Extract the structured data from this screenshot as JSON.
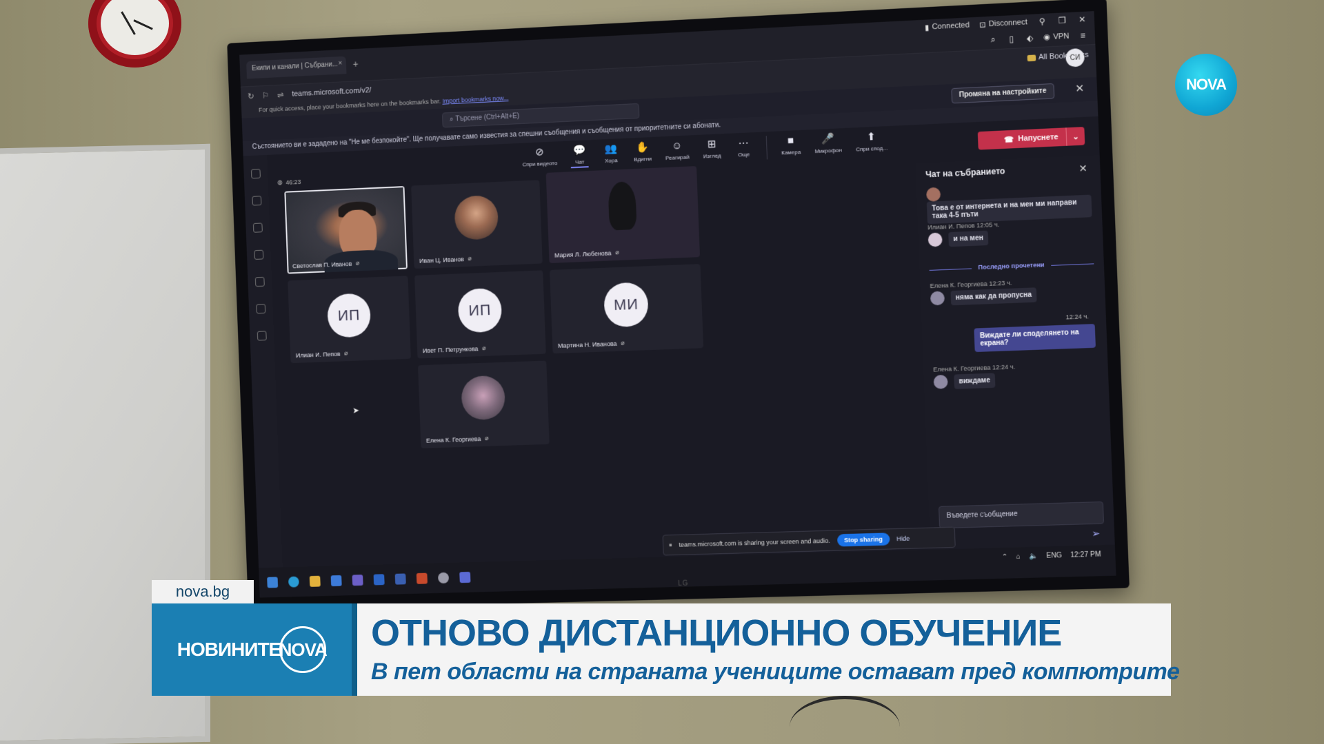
{
  "browser": {
    "tab_title": "Екипи и канали | Събрани...",
    "tab_close": "×",
    "new_tab": "+",
    "url": "teams.microsoft.com/v2/",
    "bookmarks_hint": "For quick access, place your bookmarks here on the bookmarks bar.",
    "bookmarks_link": "Import bookmarks now...",
    "connected": "Connected",
    "disconnect": "Disconnect",
    "vpn": "VPN",
    "all_bookmarks": "All Bookmarks",
    "profile_initials": "СИ"
  },
  "teams": {
    "search_placeholder": "Търсене (Ctrl+Alt+E)",
    "settings_button": "Промяна на настройките",
    "notice": "Състоянието ви е зададено на \"Не ме безпокойте\". Ще получавате само известия за спешни съобщения и съобщения от приоритетните си абонати.",
    "timer": "46:23",
    "toolbar": [
      {
        "glyph": "⊘",
        "label": "Спри видеото"
      },
      {
        "glyph": "💬",
        "label": "Чат"
      },
      {
        "glyph": "👥",
        "label": "Хора"
      },
      {
        "glyph": "✋",
        "label": "Вдигни"
      },
      {
        "glyph": "☺",
        "label": "Реагирай"
      },
      {
        "glyph": "⊞",
        "label": "Изглед"
      },
      {
        "glyph": "⋯",
        "label": "Още"
      },
      {
        "glyph": "■",
        "label": "Камера"
      },
      {
        "glyph": "🎤",
        "label": "Микрофон"
      },
      {
        "glyph": "⬆",
        "label": "Спри спод..."
      }
    ],
    "leave_button": "Напуснете",
    "participants": [
      {
        "name": "Светослав П. Иванов",
        "type": "video"
      },
      {
        "name": "Иван Ц. Иванов",
        "type": "photo"
      },
      {
        "name": "Мария Л. Любенова",
        "type": "silhouette"
      },
      {
        "name": "Илиан И. Пепов",
        "type": "initials",
        "initials": "ИП"
      },
      {
        "name": "Ивет П. Петрункова",
        "type": "initials",
        "initials": "ИП"
      },
      {
        "name": "Мартина Н. Иванова",
        "type": "initials",
        "initials": "МИ"
      },
      {
        "name": "Елена К. Георгиева",
        "type": "photo"
      }
    ],
    "chat": {
      "title": "Чат на събранието",
      "msg1": "Това е от интернета и на мен ми направи така 4-5 пъти",
      "msg2_meta": "Илиан И. Пепов  12:05 ч.",
      "msg2": "и на мен",
      "divider": "Последно прочетени",
      "msg3_meta": "Елена К. Георгиева  12:23 ч.",
      "msg3": "няма как да пропусна",
      "my_time": "12:24 ч.",
      "my_msg": "Виждате ли споделянето на екрана?",
      "msg4_meta": "Елена К. Георгиева  12:24 ч.",
      "msg4": "виждаме",
      "compose_placeholder": "Въведете съобщение"
    },
    "share_banner": {
      "text": "teams.microsoft.com is sharing your screen and audio.",
      "stop": "Stop sharing",
      "hide": "Hide"
    },
    "tray": {
      "lang": "ENG",
      "time": "12:27 PM"
    }
  },
  "tv_brand": "LG",
  "broadcast": {
    "channel_logo": "NOVA",
    "site": "nova.bg",
    "brand_left": "НОВИНИТЕ",
    "brand_right": "NOVA",
    "headline": "ОТНОВО ДИСТАНЦИОННО ОБУЧЕНИЕ",
    "subline": "В пет области на страната учениците остават пред компютрите"
  },
  "colors": {
    "teams_accent": "#7f85f5",
    "leave_red": "#c4314b",
    "nova_blue": "#1b7fb3",
    "headline_blue": "#14609a"
  }
}
